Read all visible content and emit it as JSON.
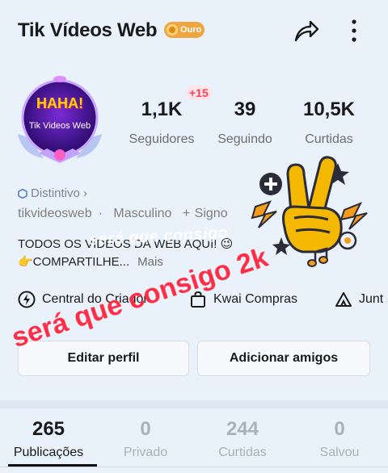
{
  "header": {
    "title": "Tik Vídeos Web",
    "badge_label": "Ouro"
  },
  "avatar": {
    "text_top": "HAHA!",
    "text_bottom": "Tik Videos Web"
  },
  "stats": {
    "new_followers": "+15",
    "followers": {
      "value": "1,1K",
      "label": "Seguidores"
    },
    "following": {
      "value": "39",
      "label": "Seguindo"
    },
    "likes": {
      "value": "10,5K",
      "label": "Curtidas"
    }
  },
  "profile": {
    "distinctive": "Distintivo ›",
    "username": "tikvideosweb",
    "separator": "·",
    "gender": "Masculino",
    "sign": "+ Signo",
    "bio_line1": "TODOS OS VÍDEOS DA WEB AQUI! 😉",
    "bio_line2": "👉COMPARTILHE...",
    "more": "Mais"
  },
  "overlay_text_faint": "será que consigo",
  "shortcuts": {
    "creator": "Central do Criador",
    "shop": "Kwai Compras",
    "join": "Junt"
  },
  "buttons": {
    "edit": "Editar perfil",
    "add_friends": "Adicionar amigos"
  },
  "caption": "será que consigo 2k",
  "tabs": [
    {
      "count": "265",
      "label": "Publicações"
    },
    {
      "count": "0",
      "label": "Privado"
    },
    {
      "count": "244",
      "label": "Curtidas"
    },
    {
      "count": "0",
      "label": "Salvou"
    }
  ],
  "colors": {
    "background": "#e9f1fa",
    "caption": "#ff2d46",
    "badge": "#f0a640",
    "sticker_yellow": "#f5b800"
  }
}
